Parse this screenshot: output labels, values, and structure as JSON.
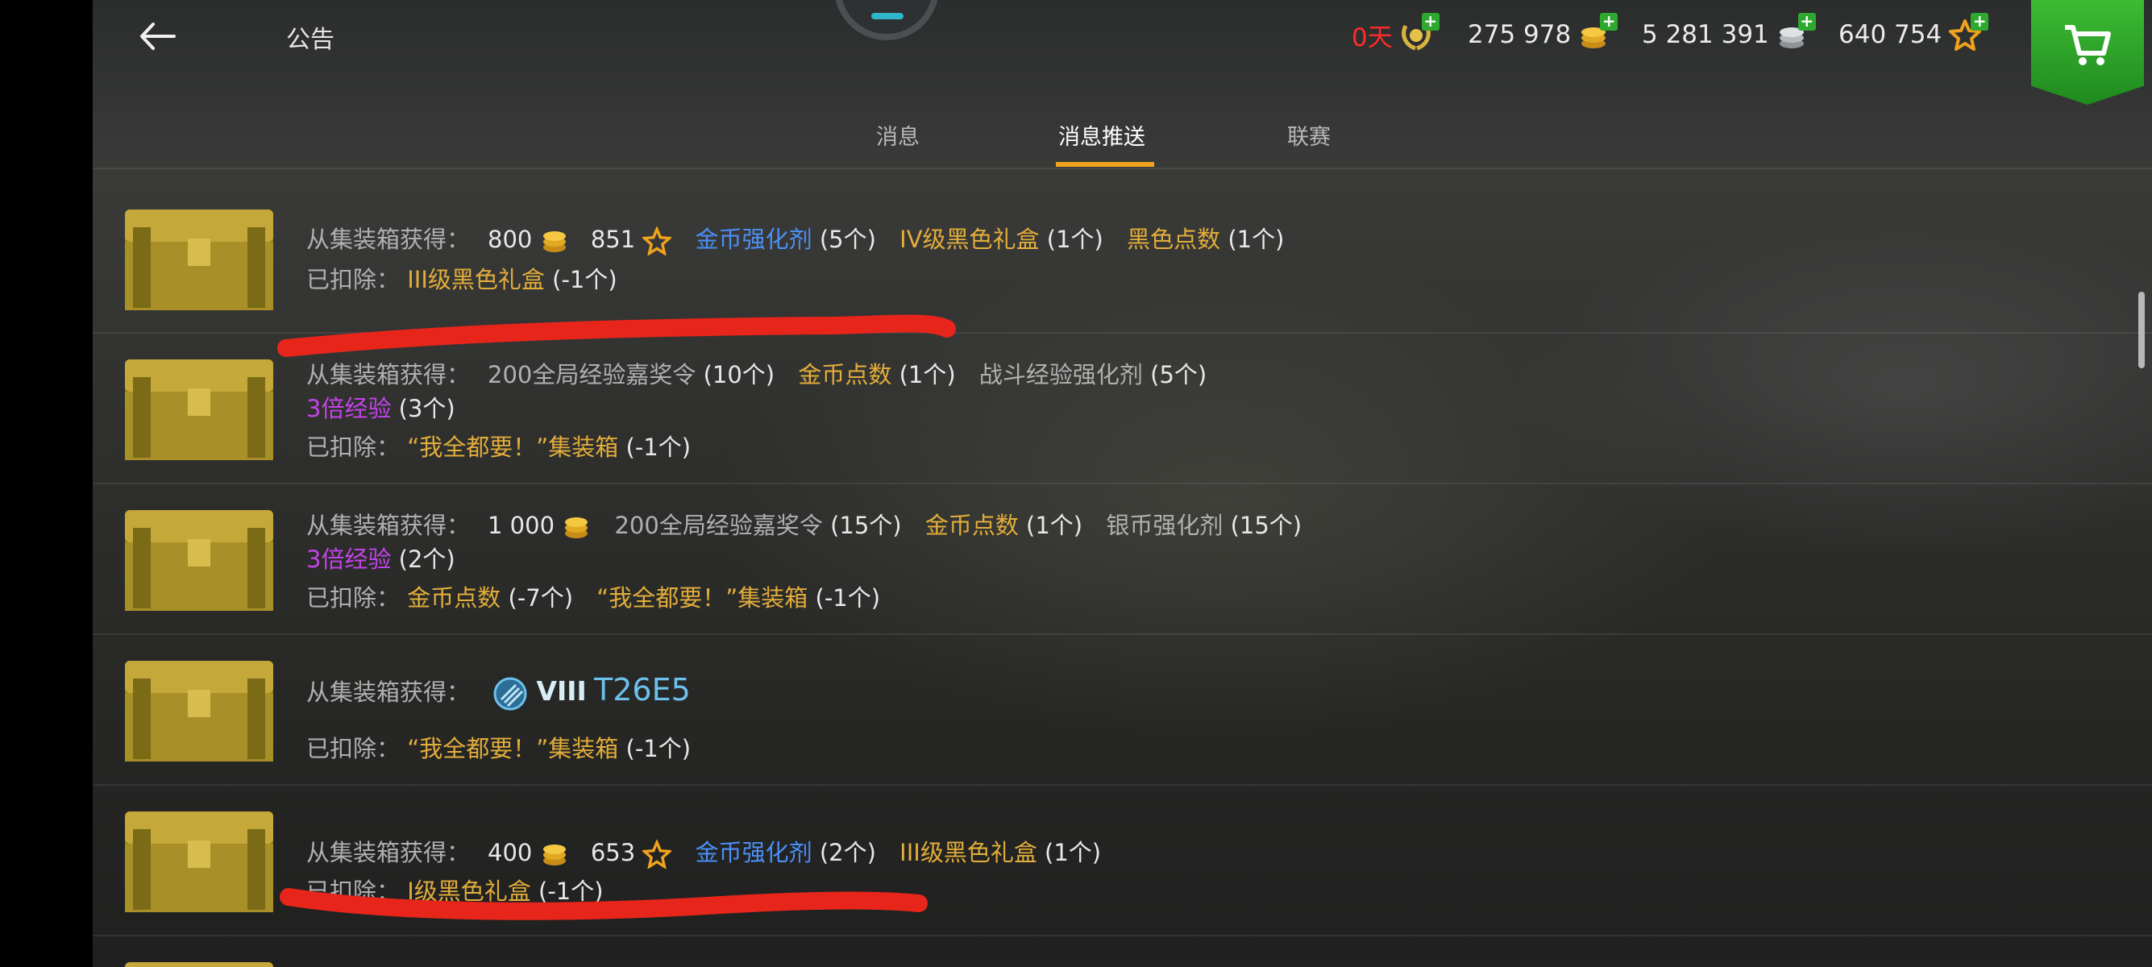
{
  "header": {
    "title": "公告",
    "currencies": [
      {
        "value": "0天",
        "icon": "premium-laurel-icon"
      },
      {
        "value": "275 978",
        "icon": "gold-coins-icon"
      },
      {
        "value": "5 281 391",
        "icon": "silver-coins-icon"
      },
      {
        "value": "640 754",
        "icon": "free-xp-star-icon"
      }
    ],
    "shop_icon": "cart-icon"
  },
  "tabs": [
    {
      "label": "消息",
      "active": false
    },
    {
      "label": "消息推送",
      "active": true
    },
    {
      "label": "联赛",
      "active": false
    }
  ],
  "rows": [
    {
      "gained_label": "从集装箱获得：",
      "g1": "800",
      "g2": "851",
      "g3": "金币强化剂",
      "g4": "(5个)",
      "g5": "IV级黑色礼盒",
      "g6": "(1个)",
      "g7": "黑色点数",
      "g8": "(1个)",
      "deducted_label": "已扣除：",
      "d1": "III级黑色礼盒",
      "d2": "(-1个)"
    },
    {
      "gained_label": "从集装箱获得：",
      "g1": "200全局经验嘉奖令",
      "g2": "(10个)",
      "g3": "金币点数",
      "g4": "(1个)",
      "g5": "战斗经验强化剂",
      "g6": "(5个)",
      "w1": "3倍经验",
      "w2": "(3个)",
      "deducted_label": "已扣除：",
      "d1": "“我全都要！”集装箱",
      "d2": "(-1个)"
    },
    {
      "gained_label": "从集装箱获得：",
      "g1": "1 000",
      "g2": "200全局经验嘉奖令",
      "g3": "(15个)",
      "g4": "金币点数",
      "g5": "(1个)",
      "g6": "银币强化剂",
      "g7": "(15个)",
      "w1": "3倍经验",
      "w2": "(2个)",
      "deducted_label": "已扣除：",
      "d1": "金币点数",
      "d2": "(-7个)",
      "d3": "“我全都要！”集装箱",
      "d4": "(-1个)"
    },
    {
      "gained_label": "从集装箱获得：",
      "tank_tier": "VIII",
      "tank_name": "T26E5",
      "deducted_label": "已扣除：",
      "d1": "“我全都要！”集装箱",
      "d2": "(-1个)"
    },
    {
      "gained_label": "从集装箱获得：",
      "g1": "400",
      "g2": "653",
      "g3": "金币强化剂",
      "g4": "(2个)",
      "g5": "III级黑色礼盒",
      "g6": "(1个)",
      "deducted_label": "已扣除：",
      "d1": "I级黑色礼盒",
      "d2": "(-1个)"
    }
  ],
  "colors": {
    "accent_orange": "#f2a21b",
    "currency_red": "#ff2a2a",
    "shop_green": "#2ea82e",
    "item_blue": "#4b8ff5",
    "item_gold": "#e3ad3a",
    "item_purple": "#c443ea",
    "annotation_red": "#e8251b"
  }
}
